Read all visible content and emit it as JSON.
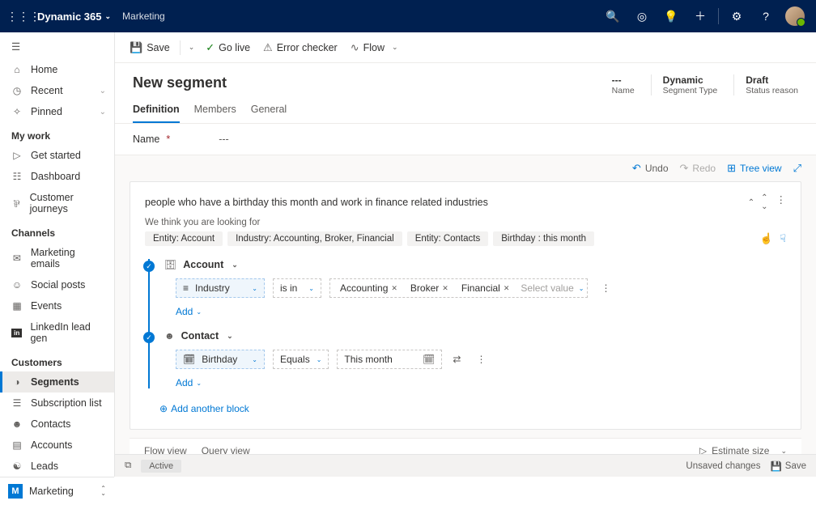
{
  "topbar": {
    "app_name": "Dynamic 365",
    "module": "Marketing"
  },
  "sidebar": {
    "nav_primary": [
      {
        "icon": "⌂",
        "label": "Home"
      },
      {
        "icon": "⏱",
        "label": "Recent",
        "chev": true
      },
      {
        "icon": "📌",
        "label": "Pinned",
        "chev": true
      }
    ],
    "group1_head": "My work",
    "group1": [
      {
        "icon": "▷",
        "label": "Get started"
      },
      {
        "icon": "☷",
        "label": "Dashboard"
      },
      {
        "icon": "⇄",
        "label": "Customer journeys"
      }
    ],
    "group2_head": "Channels",
    "group2": [
      {
        "icon": "✉",
        "label": "Marketing emails"
      },
      {
        "icon": "◉",
        "label": "Social posts"
      },
      {
        "icon": "🗓",
        "label": "Events"
      },
      {
        "icon": "in",
        "label": "LinkedIn lead gen"
      }
    ],
    "group3_head": "Customers",
    "group3": [
      {
        "icon": "◑",
        "label": "Segments",
        "active": true
      },
      {
        "icon": "🗎",
        "label": "Subscription list"
      },
      {
        "icon": "👤",
        "label": "Contacts"
      },
      {
        "icon": "🏢",
        "label": "Accounts"
      },
      {
        "icon": "☯",
        "label": "Leads"
      }
    ],
    "bottom_letter": "M",
    "bottom_label": "Marketing"
  },
  "cmdbar": {
    "save": "Save",
    "golive": "Go live",
    "error": "Error checker",
    "flow": "Flow"
  },
  "header": {
    "title": "New segment",
    "meta": [
      {
        "value": "---",
        "label": "Name"
      },
      {
        "value": "Dynamic",
        "label": "Segment Type"
      },
      {
        "value": "Draft",
        "label": "Status reason"
      }
    ]
  },
  "tabs": [
    "Definition",
    "Members",
    "General"
  ],
  "namecard": {
    "label": "Name",
    "value": "---"
  },
  "toolbar": {
    "undo": "Undo",
    "redo": "Redo",
    "tree": "Tree view"
  },
  "nlq": {
    "text": "people who have a birthday this month and work in finance related industries",
    "suggest_label": "We think you are looking for",
    "chips": [
      "Entity: Account",
      "Industry: Accounting, Broker, Financial",
      "Entity: Contacts",
      "Birthday : this month"
    ]
  },
  "blocks": [
    {
      "entity": "Account",
      "entity_icon": "🗄",
      "field": "Industry",
      "field_icon": "≡",
      "op": "is in",
      "values": [
        "Accounting",
        "Broker",
        "Financial"
      ],
      "select_placeholder": "Select value",
      "add": "Add"
    },
    {
      "entity": "Contact",
      "entity_icon": "👤",
      "field": "Birthday",
      "field_icon": "🗓",
      "op": "Equals",
      "value_text": "This month",
      "add": "Add"
    }
  ],
  "addblock": "Add another block",
  "viewbar": {
    "flow": "Flow view",
    "query": "Query view",
    "est": "Estimate size"
  },
  "footer": {
    "status": "Active",
    "unsaved": "Unsaved changes",
    "save": "Save"
  }
}
